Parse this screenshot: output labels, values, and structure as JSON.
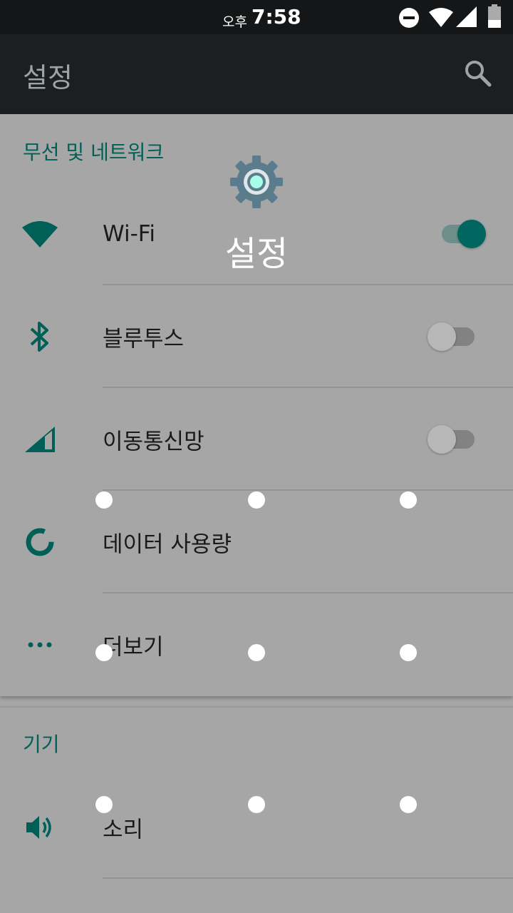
{
  "status_bar": {
    "ampm": "오후",
    "time": "7:58",
    "icons": [
      "do-not-disturb-icon",
      "wifi-icon",
      "signal-icon",
      "battery-icon"
    ]
  },
  "toolbar": {
    "title": "설정",
    "search_icon": "search-icon"
  },
  "sections": [
    {
      "header": "무선 및 네트워크",
      "items": [
        {
          "label": "Wi-Fi",
          "icon": "wifi-icon",
          "toggle": "on"
        },
        {
          "label": "블루투스",
          "icon": "bluetooth-icon",
          "toggle": "off"
        },
        {
          "label": "이동통신망",
          "icon": "cellular-icon",
          "toggle": "off"
        },
        {
          "label": "데이터 사용량",
          "icon": "data-usage-icon"
        },
        {
          "label": "더보기",
          "icon": "more-icon"
        }
      ]
    },
    {
      "header": "기기",
      "items": [
        {
          "label": "소리",
          "icon": "volume-icon"
        }
      ]
    }
  ],
  "splash": {
    "title": "설정",
    "icon": "settings-gear-icon"
  },
  "colors": {
    "accent": "#00665f",
    "status_bar": "#141617",
    "toolbar": "#1b1f22",
    "background": "#a6a6a6"
  }
}
